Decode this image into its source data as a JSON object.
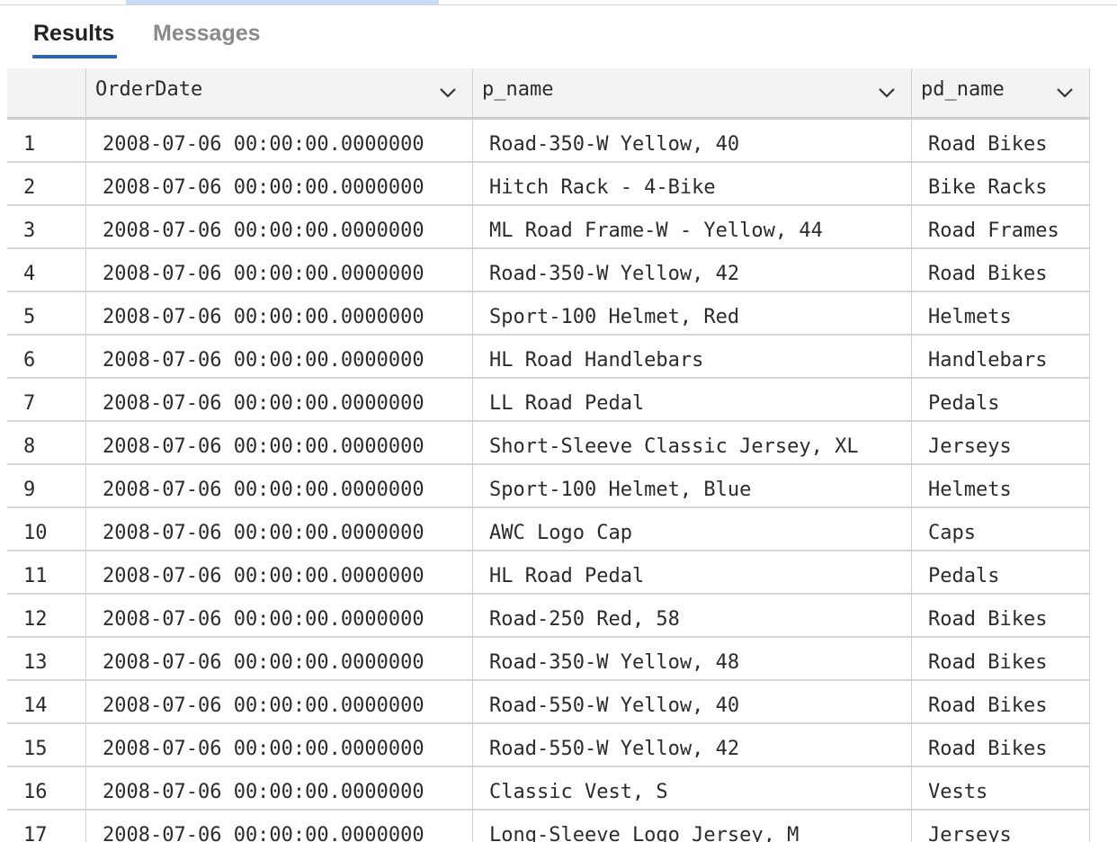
{
  "tabs": [
    {
      "label": "Results",
      "active": true
    },
    {
      "label": "Messages",
      "active": false
    }
  ],
  "grid": {
    "columns": [
      "",
      "OrderDate",
      "p_name",
      "pd_name"
    ],
    "rows": [
      [
        "1",
        "2008-07-06 00:00:00.0000000",
        "Road-350-W Yellow, 40",
        "Road Bikes"
      ],
      [
        "2",
        "2008-07-06 00:00:00.0000000",
        "Hitch Rack - 4-Bike",
        "Bike Racks"
      ],
      [
        "3",
        "2008-07-06 00:00:00.0000000",
        "ML Road Frame-W - Yellow, 44",
        "Road Frames"
      ],
      [
        "4",
        "2008-07-06 00:00:00.0000000",
        "Road-350-W Yellow, 42",
        "Road Bikes"
      ],
      [
        "5",
        "2008-07-06 00:00:00.0000000",
        "Sport-100 Helmet, Red",
        "Helmets"
      ],
      [
        "6",
        "2008-07-06 00:00:00.0000000",
        "HL Road Handlebars",
        "Handlebars"
      ],
      [
        "7",
        "2008-07-06 00:00:00.0000000",
        "LL Road Pedal",
        "Pedals"
      ],
      [
        "8",
        "2008-07-06 00:00:00.0000000",
        "Short-Sleeve Classic Jersey, XL",
        "Jerseys"
      ],
      [
        "9",
        "2008-07-06 00:00:00.0000000",
        "Sport-100 Helmet, Blue",
        "Helmets"
      ],
      [
        "10",
        "2008-07-06 00:00:00.0000000",
        "AWC Logo Cap",
        "Caps"
      ],
      [
        "11",
        "2008-07-06 00:00:00.0000000",
        "HL Road Pedal",
        "Pedals"
      ],
      [
        "12",
        "2008-07-06 00:00:00.0000000",
        "Road-250 Red, 58",
        "Road Bikes"
      ],
      [
        "13",
        "2008-07-06 00:00:00.0000000",
        "Road-350-W Yellow, 48",
        "Road Bikes"
      ],
      [
        "14",
        "2008-07-06 00:00:00.0000000",
        "Road-550-W Yellow, 40",
        "Road Bikes"
      ],
      [
        "15",
        "2008-07-06 00:00:00.0000000",
        "Road-550-W Yellow, 42",
        "Road Bikes"
      ],
      [
        "16",
        "2008-07-06 00:00:00.0000000",
        "Classic Vest, S",
        "Vests"
      ],
      [
        "17",
        "2008-07-06 00:00:00.0000000",
        "Long-Sleeve Logo Jersey, M",
        "Jerseys"
      ]
    ]
  },
  "icons": {
    "column_menu": "chevron-down-icon"
  },
  "colors": {
    "accent": "#2a66b8",
    "header_bg": "#f3f3f3",
    "text": "#2b2b2b",
    "inactive_tab": "#8a8a8a"
  }
}
